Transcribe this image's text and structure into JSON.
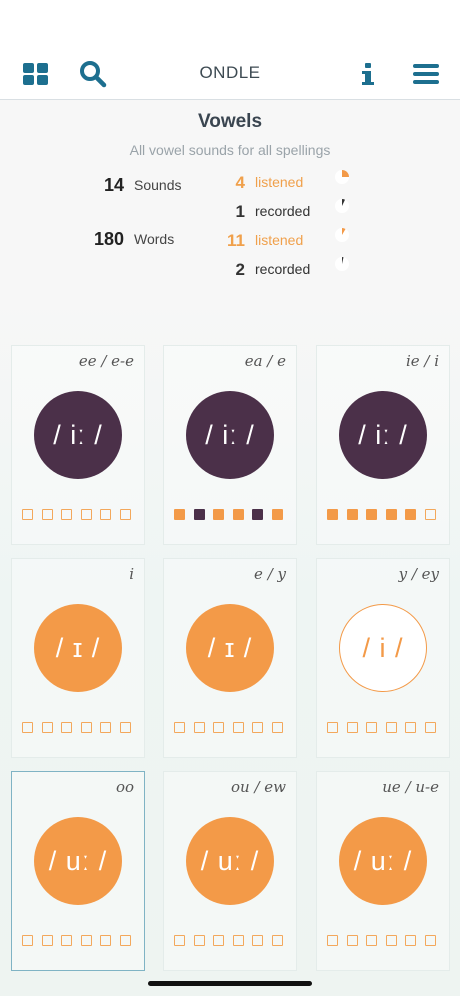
{
  "header": {
    "title": "ONDLE"
  },
  "summary": {
    "title": "Vowels",
    "subtitle": "All vowel sounds for all spellings",
    "sounds": {
      "count": "14",
      "label": "Sounds",
      "listened": "4",
      "listened_label": "listened",
      "recorded": "1",
      "recorded_label": "recorded"
    },
    "words": {
      "count": "180",
      "label": "Words",
      "listened": "11",
      "listened_label": "listened",
      "recorded": "2",
      "recorded_label": "recorded"
    }
  },
  "cards": [
    {
      "spelling": "ee / e-e",
      "symbol": "/ iː /",
      "style": "purple",
      "progress": [
        "e",
        "e",
        "e",
        "e",
        "e",
        "e"
      ]
    },
    {
      "spelling": "ea / e",
      "symbol": "/ iː /",
      "style": "purple",
      "progress": [
        "o",
        "p",
        "o",
        "o",
        "p",
        "o"
      ]
    },
    {
      "spelling": "ie / i",
      "symbol": "/ iː /",
      "style": "purple",
      "progress": [
        "o",
        "o",
        "o",
        "o",
        "o",
        "e"
      ]
    },
    {
      "spelling": "i",
      "symbol": "/ ɪ /",
      "style": "orange",
      "progress": [
        "e",
        "e",
        "e",
        "e",
        "e",
        "e"
      ]
    },
    {
      "spelling": "e / y",
      "symbol": "/ ɪ /",
      "style": "orange",
      "progress": [
        "e",
        "e",
        "e",
        "e",
        "e",
        "e"
      ]
    },
    {
      "spelling": "y / ey",
      "symbol": "/ i /",
      "style": "outline",
      "progress": [
        "e",
        "e",
        "e",
        "e",
        "e",
        "e"
      ]
    },
    {
      "spelling": "oo",
      "symbol": "/ uː /",
      "style": "orange",
      "selected": true,
      "progress": [
        "e",
        "e",
        "e",
        "e",
        "e",
        "e"
      ]
    },
    {
      "spelling": "ou / ew",
      "symbol": "/ uː /",
      "style": "orange",
      "progress": [
        "e",
        "e",
        "e",
        "e",
        "e",
        "e"
      ]
    },
    {
      "spelling": "ue / u-e",
      "symbol": "/ uː /",
      "style": "orange",
      "progress": [
        "e",
        "e",
        "e",
        "e",
        "e",
        "e"
      ]
    }
  ],
  "icons": {
    "grid": "grid-icon",
    "search": "search-icon",
    "info": "info-icon",
    "menu": "menu-icon"
  },
  "colors": {
    "accent": "#f39a48",
    "purple": "#4b3049",
    "nav_icon": "#1d6f8f"
  }
}
